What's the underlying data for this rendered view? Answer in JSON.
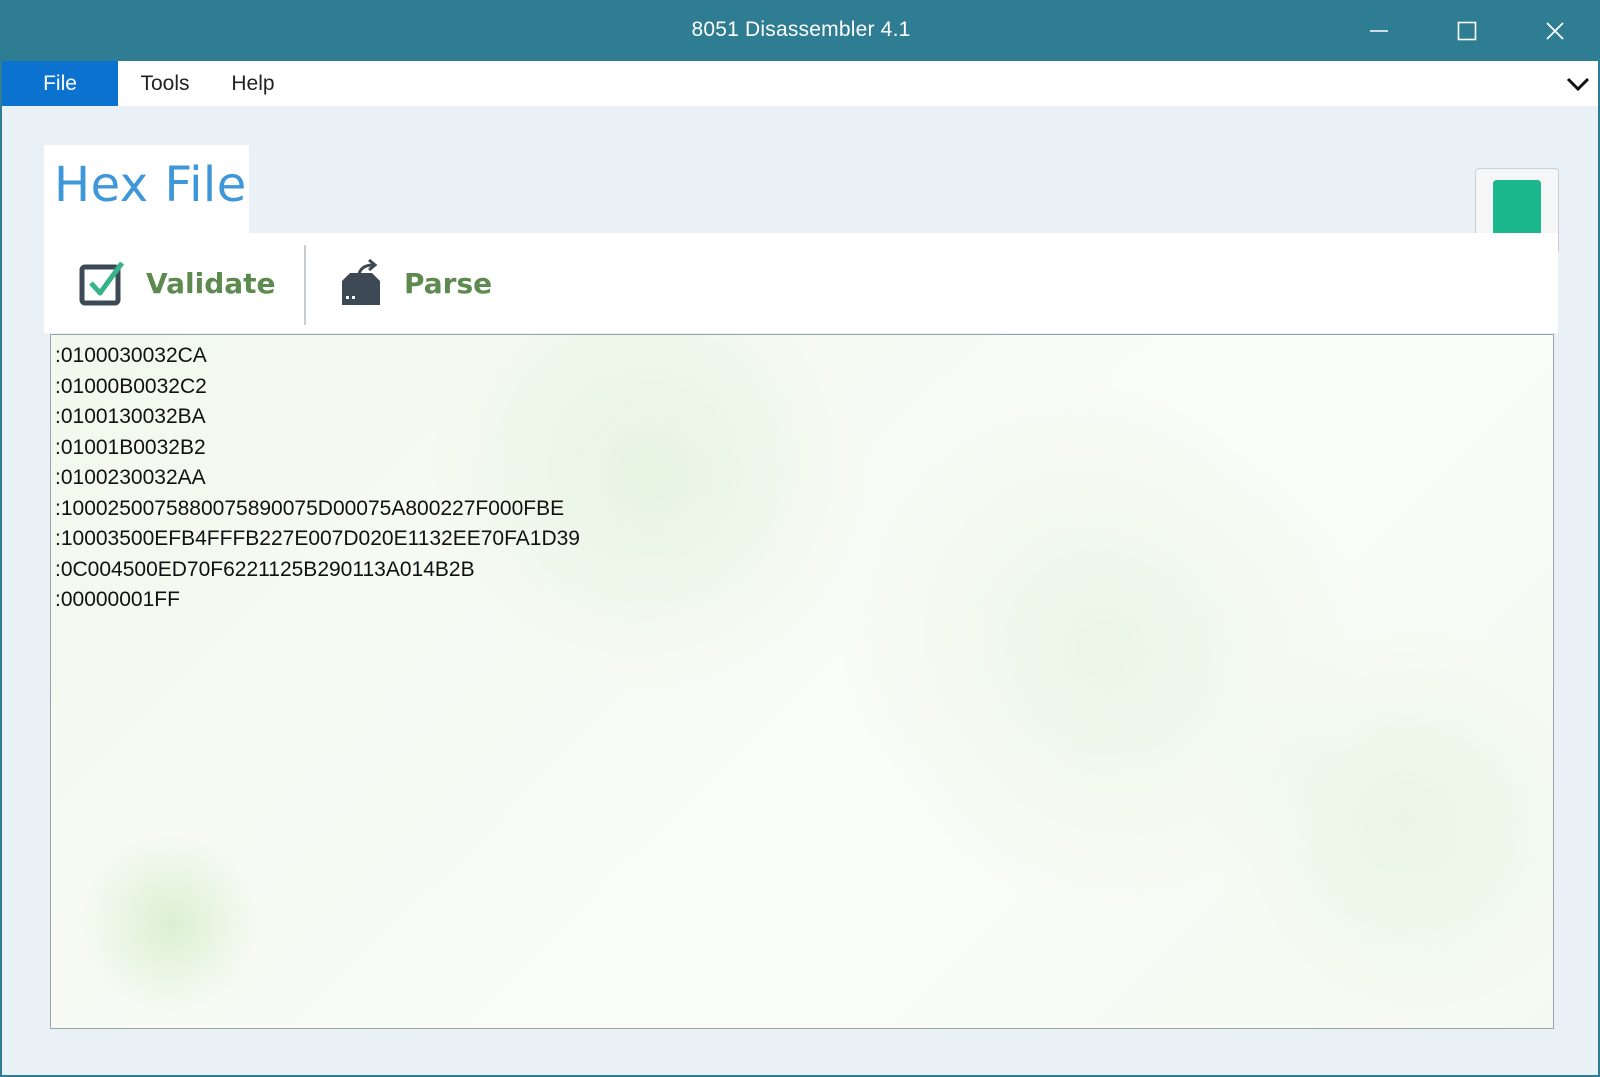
{
  "window": {
    "title": "8051 Disassembler 4.1",
    "controls": [
      "minimize",
      "maximize",
      "close"
    ]
  },
  "menu": {
    "items": [
      {
        "label": "File",
        "active": true
      },
      {
        "label": "Tools",
        "active": false
      },
      {
        "label": "Help",
        "active": false
      }
    ],
    "overflow_icon": "chevron-down-icon"
  },
  "page": {
    "title": "Hex File",
    "help_icon": "book-icon"
  },
  "toolbar": {
    "validate_label": "Validate",
    "validate_icon": "checkbox-checked-icon",
    "parse_label": "Parse",
    "parse_icon": "drive-export-icon"
  },
  "hex": {
    "lines": [
      ":0100030032CA",
      ":01000B0032C2",
      ":0100130032BA",
      ":01001B0032B2",
      ":0100230032AA",
      ":100025007588007589007 5D00075A800227F000FBE",
      ":10003500EFB4FFFB227E007D020E1132EE70FA1D39",
      ":0C004500ED70F6221125B290113A014B2B",
      ":00000001FF"
    ]
  },
  "colors": {
    "titlebar": "#2f7d92",
    "menu_active": "#0b72d0",
    "page_title": "#3e97d8",
    "tool_label": "#5d8a4e",
    "book": "#1fbf95"
  }
}
